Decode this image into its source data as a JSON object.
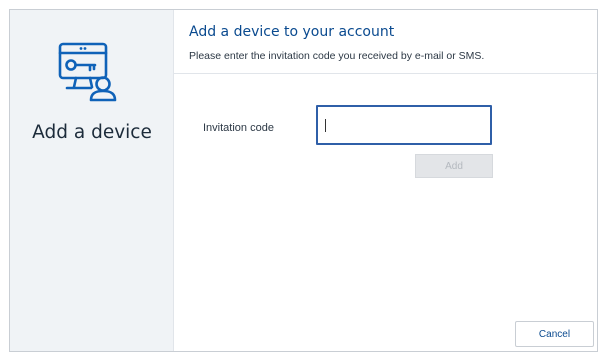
{
  "sidebar": {
    "icon": "device-key-user-icon",
    "title": "Add a device"
  },
  "header": {
    "title": "Add a device to your account",
    "subtitle": "Please enter the invitation code you received by e-mail or SMS."
  },
  "form": {
    "invitation_code_label": "Invitation code",
    "invitation_code_value": "",
    "add_label": "Add"
  },
  "footer": {
    "cancel_label": "Cancel"
  },
  "colors": {
    "accent": "#0a4a8f",
    "input_border": "#2f5fa8",
    "sidebar_bg": "#f0f3f6",
    "disabled_button_bg": "#e3e5e8"
  }
}
